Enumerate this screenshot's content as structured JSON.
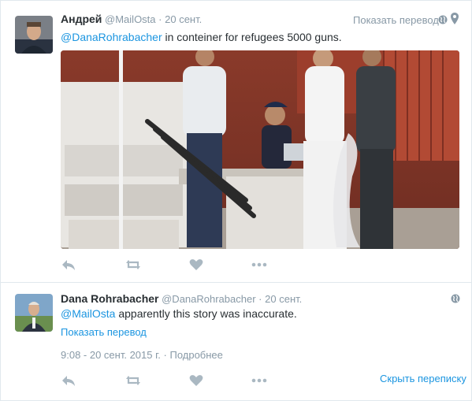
{
  "tweet1": {
    "author_name": "Андрей",
    "author_handle": "@MailOsta",
    "separator": "·",
    "time": "20 сент.",
    "translate_label": "Показать перевод",
    "mention": "@DanaRohrabacher",
    "text": " in conteiner for refugees 5000 guns.",
    "actions": [
      "reply-icon",
      "retweet-icon",
      "like-icon",
      "more-icon"
    ]
  },
  "tweet2": {
    "author_name": "Dana Rohrabacher",
    "author_handle": "@DanaRohrabacher",
    "separator": "·",
    "time": "20 сент.",
    "mention": "@MailOsta",
    "text": " apparently this story was inaccurate.",
    "translate_label": "Показать перевод",
    "timestamp": "9:08 - 20 сент. 2015 г.",
    "meta_separator": "·",
    "details_label": "Подробнее",
    "hide_conversation_label": "Скрыть переписку",
    "actions": [
      "reply-icon",
      "retweet-icon",
      "like-icon",
      "more-icon"
    ]
  },
  "colors": {
    "link": "#1b95e0",
    "muted": "#8899a6",
    "text": "#292f33",
    "border": "#e1e8ed"
  }
}
